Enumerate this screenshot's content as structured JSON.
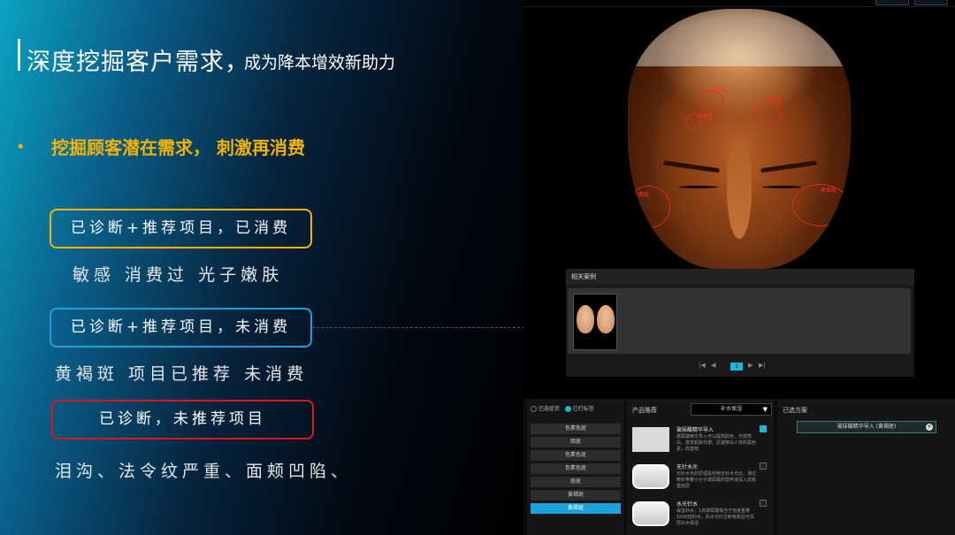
{
  "slide": {
    "title_main": "深度挖掘客户需求，",
    "title_sub": "成为降本增效新助力",
    "bullet": "挖掘顾客潜在需求， 刺激再消费",
    "cards": [
      {
        "label": "已诊断+推荐项目，已消费",
        "detail": "敏感  消费过  光子嫩肤",
        "color": "#f3b400"
      },
      {
        "label": "已诊断+推荐项目，未消费",
        "detail": "黄褐斑  项目已推荐  未消费",
        "color": "#1aa2d8"
      },
      {
        "label": "已诊断，未推荐项目",
        "detail": "泪沟、法令纹严重、面颊凹陷、",
        "color": "#e0141c"
      }
    ]
  },
  "app": {
    "face_marks": [
      "色素斑",
      "色素斑",
      "色素斑",
      "色素斑",
      "黄褐斑"
    ],
    "cases_title": "相关案例",
    "pager": {
      "first": "|◀",
      "prev": "◀",
      "current": "1",
      "next": "▶",
      "last": "▶|"
    },
    "filter": {
      "option_a": "已选症状",
      "option_b": "已打标签"
    },
    "symptoms": [
      "色素色斑",
      "暗斑",
      "色素色斑",
      "色素色斑",
      "痘斑",
      "黄褐斑",
      "黄褐斑"
    ],
    "products": {
      "title": "产品推荐",
      "dropdown": "补水保湿",
      "items": [
        {
          "name": "玻尿酸精华导入",
          "desc": "玻尿酸精华导入可以提亮肤色、光感亮白，激发肌肤代谢，迅速排出人体的黑色素，改善暗",
          "checked": true
        },
        {
          "name": "无针水光",
          "desc": "无针水光的原理是利用无针水光仪，通过微针带着小分子玻尿酸的营养液深入皮肤基底层",
          "checked": false
        },
        {
          "name": "水光针水",
          "desc": "保湿补水：1克玻尿酸相当于自身重量1000倍的水，而水光针注射吸收后可深层补水保湿",
          "checked": false
        }
      ]
    },
    "selected": {
      "title": "已选方案",
      "item": "玻尿酸精华导入 (黄褐斑)"
    }
  }
}
